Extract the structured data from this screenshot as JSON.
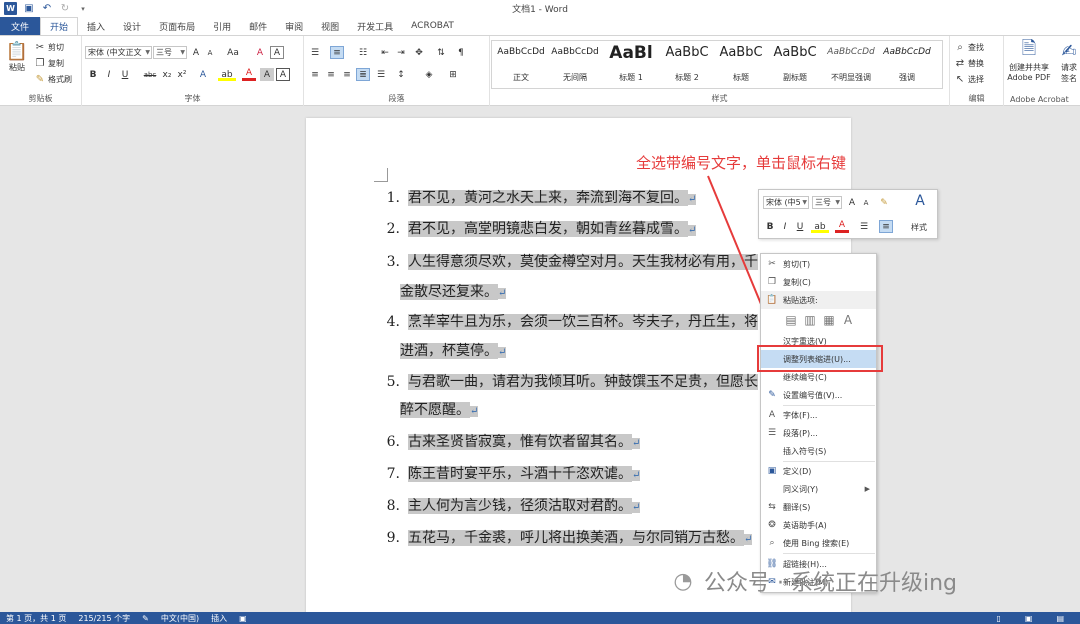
{
  "app": {
    "title": "文档1 - Word",
    "logo": "W"
  },
  "qat": {
    "save_icon": "save-icon",
    "undo_icon": "undo-icon",
    "redo_icon": "redo-icon",
    "customize_icon": "chevron-down-icon"
  },
  "tabs": [
    {
      "label": "文件"
    },
    {
      "label": "开始"
    },
    {
      "label": "插入"
    },
    {
      "label": "设计"
    },
    {
      "label": "页面布局"
    },
    {
      "label": "引用"
    },
    {
      "label": "邮件"
    },
    {
      "label": "审阅"
    },
    {
      "label": "视图"
    },
    {
      "label": "开发工具"
    },
    {
      "label": "ACROBAT"
    }
  ],
  "ribbon": {
    "clipboard": {
      "label": "剪贴板",
      "paste": "粘贴",
      "cut": "剪切",
      "copy": "复制",
      "format_painter": "格式刷"
    },
    "font": {
      "label": "字体",
      "font_name": "宋体 (中文正文",
      "font_size": "三号",
      "grow": "A",
      "shrink": "A",
      "case": "Aa",
      "clear": "A",
      "bold": "B",
      "italic": "I",
      "underline": "U",
      "strike": "abc",
      "sub": "x₂",
      "sup": "x²",
      "effects": "A",
      "highlight": "ab",
      "color": "A",
      "shade": "A",
      "border": "A"
    },
    "paragraph": {
      "label": "段落"
    },
    "styles": {
      "label": "样式",
      "items": [
        {
          "sample": "AaBbCcDd",
          "name": "正文"
        },
        {
          "sample": "AaBbCcDd",
          "name": "无间隔"
        },
        {
          "sample": "AaBl",
          "name": "标题 1"
        },
        {
          "sample": "AaBbC",
          "name": "标题 2"
        },
        {
          "sample": "AaBbC",
          "name": "标题"
        },
        {
          "sample": "AaBbC",
          "name": "副标题"
        },
        {
          "sample": "AaBbCcDd",
          "name": "不明显强调"
        },
        {
          "sample": "AaBbCcDd",
          "name": "强调"
        }
      ]
    },
    "editing": {
      "label": "编辑",
      "find": "查找",
      "replace": "替换",
      "select": "选择"
    },
    "acrobat": {
      "label": "Adobe Acrobat",
      "create_share_1": "创建并共享",
      "create_share_2": "Adobe PDF",
      "request_1": "请求",
      "request_2": "签名"
    }
  },
  "document": {
    "lines": [
      {
        "num": "1.",
        "text": "君不见，黄河之水天上来，奔流到海不复回。"
      },
      {
        "num": "2.",
        "text": "君不见，高堂明镜悲白发，朝如青丝暮成雪。"
      },
      {
        "num": "3.",
        "text": "人生得意须尽欢，莫使金樽空对月。天生我材必有用，千"
      },
      {
        "num": "",
        "text": "金散尽还复来。"
      },
      {
        "num": "4.",
        "text": "烹羊宰牛且为乐，会须一饮三百杯。岑夫子，丹丘生，将"
      },
      {
        "num": "",
        "text": "进酒，杯莫停。"
      },
      {
        "num": "5.",
        "text": "与君歌一曲，请君为我倾耳听。钟鼓馔玉不足贵，但愿长"
      },
      {
        "num": "",
        "text": "醉不愿醒。"
      },
      {
        "num": "6.",
        "text": "古来圣贤皆寂寞，惟有饮者留其名。"
      },
      {
        "num": "7.",
        "text": "陈王昔时宴平乐，斗酒十千恣欢谑。"
      },
      {
        "num": "8.",
        "text": "主人何为言少钱，径须沽取对君酌。"
      },
      {
        "num": "9.",
        "text": "五花马，千金裘，呼儿将出换美酒，与尔同销万古愁。"
      }
    ],
    "para_mark": "↵"
  },
  "annotation": "全选带编号文字，单击鼠标右键",
  "mini_toolbar": {
    "font": "宋体 (中5",
    "size": "三号",
    "grow": "A",
    "shrink": "A",
    "styles_label": "样式",
    "bold": "B",
    "italic": "I",
    "underline": "U",
    "highlight": "ab",
    "color": "A"
  },
  "context_menu": {
    "cut": "剪切(T)",
    "copy": "复制(C)",
    "paste_options": "粘贴选项:",
    "reconvert": "汉字重选(V)",
    "adjust_indent": "调整列表缩进(U)...",
    "continue_numbering": "继续编号(C)",
    "set_numbering": "设置编号值(V)...",
    "font": "字体(F)...",
    "paragraph": "段落(P)...",
    "insert_symbol": "插入符号(S)",
    "define": "定义(D)",
    "synonyms": "同义词(Y)",
    "translate": "翻译(S)",
    "english_helper": "英语助手(A)",
    "bing_search": "使用 Bing 搜索(E)",
    "hyperlink": "超链接(H)...",
    "new_comment": "新建批注(M)"
  },
  "watermark": "公众号 · 系统正在升级ing",
  "status": {
    "page": "第 1 页，共 1 页",
    "words": "215/215 个字",
    "proof_icon": "proofing-icon",
    "lang": "中文(中国)",
    "mode": "插入",
    "macro_icon": "macro-icon"
  }
}
